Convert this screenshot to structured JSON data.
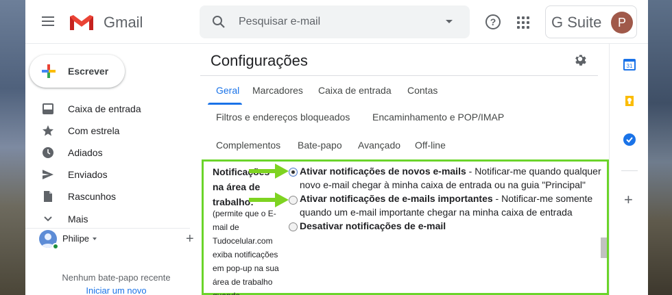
{
  "header": {
    "app_name": "Gmail",
    "search_placeholder": "Pesquisar e-mail",
    "help_glyph": "?",
    "brand_label": "G Suite",
    "avatar_initial": "P"
  },
  "sidebar": {
    "compose_label": "Escrever",
    "items": [
      {
        "label": "Caixa de entrada",
        "icon": "inbox-icon"
      },
      {
        "label": "Com estrela",
        "icon": "star-icon"
      },
      {
        "label": "Adiados",
        "icon": "clock-icon"
      },
      {
        "label": "Enviados",
        "icon": "send-icon"
      },
      {
        "label": "Rascunhos",
        "icon": "draft-icon"
      },
      {
        "label": "Mais",
        "icon": "chevron-down-icon"
      }
    ],
    "user_name": "Philipe",
    "add_glyph": "+",
    "chat_empty": "Nenhum bate-papo recente",
    "chat_link": "Iniciar um novo"
  },
  "settings": {
    "title": "Configurações",
    "tabs_row1": [
      "Geral",
      "Marcadores",
      "Caixa de entrada",
      "Contas"
    ],
    "tabs_row2": [
      "Filtros e endereços bloqueados",
      "Encaminhamento e POP/IMAP"
    ],
    "tabs_row3": [
      "Complementos",
      "Bate-papo",
      "Avançado",
      "Off-line"
    ],
    "active_tab": "Geral",
    "section_label": "Notificações na área de trabalho:",
    "section_desc": "(permite que o E-mail de Tudocelular.com exiba notificações em pop-up na sua área de trabalho quando...",
    "options": [
      {
        "title": "Ativar notificações de novos e-mails",
        "desc": " - Notificar-me quando qualquer novo e-mail chegar à minha caixa de entrada ou na guia \"Principal\"",
        "selected": true
      },
      {
        "title": "Ativar notificações de e-mails importantes",
        "desc": " - Notificar-me somente quando um e-mail importante chegar na minha caixa de entrada",
        "selected": false
      },
      {
        "title": "Desativar notificações de e-mail",
        "desc": "",
        "selected": false
      }
    ]
  },
  "colors": {
    "accent": "#1a73e8",
    "highlight_box": "#6bd42a",
    "annotation_arrow": "#7ed321",
    "avatar": "#a0594a"
  },
  "side_panel": {
    "icons": [
      "calendar-icon",
      "keep-icon",
      "tasks-icon"
    ],
    "calendar_day": "31",
    "add_glyph": "+"
  }
}
